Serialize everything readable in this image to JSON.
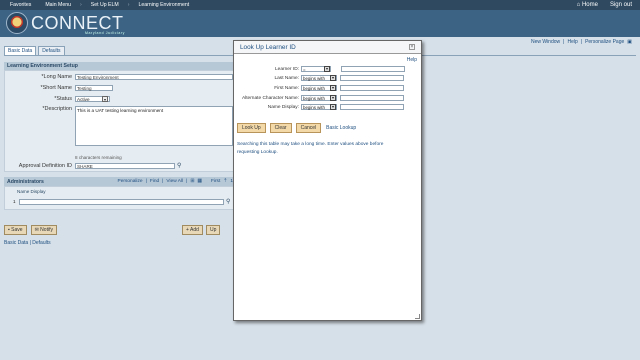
{
  "topbar": {
    "nav": [
      "Favorites",
      "Main Menu",
      "Set Up ELM",
      "Learning Environment"
    ],
    "home_label": "Home",
    "signout_label": "Sign out"
  },
  "header": {
    "logo_text": "CONNECT",
    "logo_sub": "Maryland Judiciary"
  },
  "toplinks": [
    "New Window",
    "Help",
    "Personalize Page"
  ],
  "tabs": [
    "Basic Data",
    "Defaults"
  ],
  "learning_env": {
    "title": "Learning Environment Setup",
    "long_name_label": "*Long Name",
    "long_name_value": "Testing Environment",
    "short_name_label": "*Short Name",
    "short_name_value": "Testing",
    "status_label": "*Status",
    "status_value": "Active",
    "description_label": "*Description",
    "description_value": "This is a UAT testing learning environment",
    "remaining": "8 characters remaining",
    "approval_label": "Approval Definition ID",
    "approval_value": "SHARE"
  },
  "admins": {
    "title": "Administrators",
    "links": [
      "Personalize",
      "Find",
      "View All"
    ],
    "first_label": "First",
    "page_num": "1",
    "col": "Name Display",
    "row_num": "1"
  },
  "buttons": {
    "save": "Save",
    "notify": "Notify",
    "add": "Add",
    "update": "Up"
  },
  "bottomlinks": "Basic Data | Defaults",
  "modal": {
    "title": "Look Up Learner ID",
    "help": "Help",
    "fields": [
      {
        "label": "Learner ID:",
        "op": "="
      },
      {
        "label": "Last Name:",
        "op": "begins with"
      },
      {
        "label": "First Name:",
        "op": "begins with"
      },
      {
        "label": "Alternate Character Name:",
        "op": "begins with"
      },
      {
        "label": "Name Display:",
        "op": "begins with"
      }
    ],
    "lookup_btn": "Look Up",
    "clear_btn": "Clear",
    "cancel_btn": "Cancel",
    "basic_lookup": "Basic Lookup",
    "note": "Searching this table may take a long time. Enter values above before requesting Lookup."
  },
  "colors": {
    "topbar": "#2e4960",
    "header": "#3d6384",
    "page_bg": "#d6e0e8",
    "button": "#f3d9a8"
  }
}
